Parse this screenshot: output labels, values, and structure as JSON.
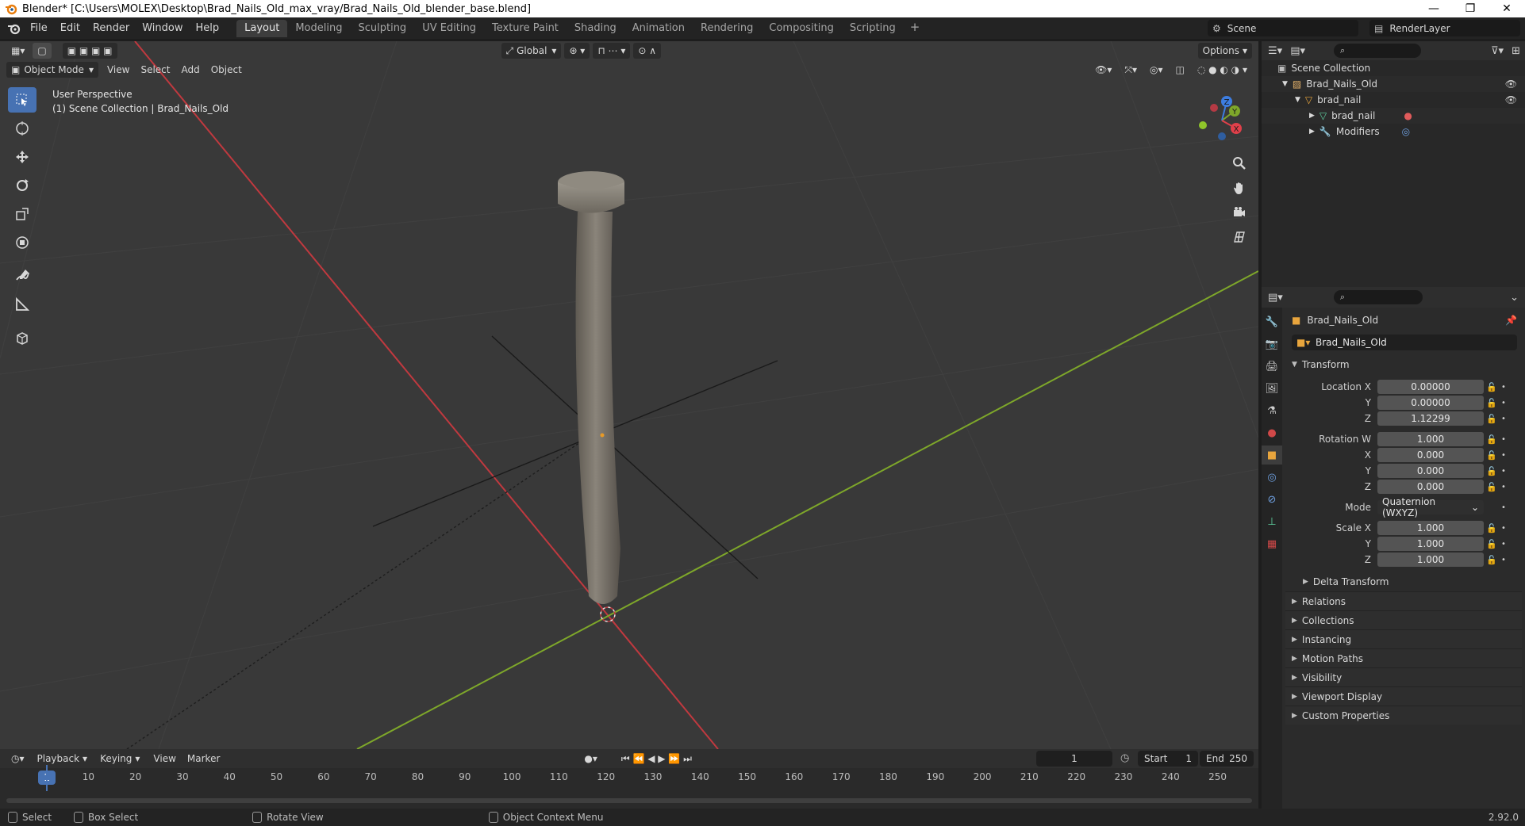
{
  "window": {
    "title": "Blender* [C:\\Users\\MOLEX\\Desktop\\Brad_Nails_Old_max_vray/Brad_Nails_Old_blender_base.blend]",
    "minimize": "—",
    "restore": "❐",
    "close": "✕"
  },
  "menubar": {
    "items": [
      "File",
      "Edit",
      "Render",
      "Window",
      "Help"
    ],
    "workspaces": [
      "Layout",
      "Modeling",
      "Sculpting",
      "UV Editing",
      "Texture Paint",
      "Shading",
      "Animation",
      "Rendering",
      "Compositing",
      "Scripting"
    ],
    "active_workspace": "Layout",
    "add_workspace": "+",
    "scene": "Scene",
    "render_layer": "RenderLayer"
  },
  "viewport": {
    "mode": "Object Mode",
    "menus": [
      "View",
      "Select",
      "Add",
      "Object"
    ],
    "orientation": "Global",
    "options_label": "Options",
    "overlay_line1": "User Perspective",
    "overlay_line2": "(1) Scene Collection | Brad_Nails_Old",
    "gizmo_axes": {
      "x": "X",
      "y": "Y",
      "z": "Z"
    },
    "colors": {
      "background": "#393939",
      "x_axis": "#c0393f",
      "y_axis": "#7ea72a",
      "active_tool": "#4772b3"
    }
  },
  "timeline": {
    "menus": [
      "Playback",
      "Keying",
      "View",
      "Marker"
    ],
    "current_frame": "1",
    "start_label": "Start",
    "start_value": "1",
    "end_label": "End",
    "end_value": "250",
    "ruler_current": "1",
    "ruler_ticks": [
      "10",
      "20",
      "30",
      "40",
      "50",
      "60",
      "70",
      "80",
      "90",
      "100",
      "110",
      "120",
      "130",
      "140",
      "150",
      "160",
      "170",
      "180",
      "190",
      "200",
      "210",
      "220",
      "230",
      "240",
      "250"
    ]
  },
  "statusbar": {
    "select": "Select",
    "box_select": "Box Select",
    "rotate_view": "Rotate View",
    "context_menu": "Object Context Menu",
    "version": "2.92.0"
  },
  "outliner": {
    "root": "Scene Collection",
    "rows": [
      {
        "label": "Brad_Nails_Old"
      },
      {
        "label": "brad_nail"
      },
      {
        "label": "brad_nail"
      },
      {
        "label": "Modifiers"
      }
    ]
  },
  "properties": {
    "object_name_header": "Brad_Nails_Old",
    "object_name_field": "Brad_Nails_Old",
    "transform_title": "Transform",
    "location": {
      "label_x": "Location X",
      "label_y": "Y",
      "label_z": "Z",
      "x": "0.00000",
      "y": "0.00000",
      "z": "1.12299"
    },
    "rotation": {
      "label_w": "Rotation W",
      "label_x": "X",
      "label_y": "Y",
      "label_z": "Z",
      "w": "1.000",
      "x": "0.000",
      "y": "0.000",
      "z": "0.000"
    },
    "mode_label": "Mode",
    "mode_value": "Quaternion (WXYZ)",
    "scale": {
      "label_x": "Scale X",
      "label_y": "Y",
      "label_z": "Z",
      "x": "1.000",
      "y": "1.000",
      "z": "1.000"
    },
    "delta_transform": "Delta Transform",
    "panels": [
      "Relations",
      "Collections",
      "Instancing",
      "Motion Paths",
      "Visibility",
      "Viewport Display",
      "Custom Properties"
    ]
  }
}
